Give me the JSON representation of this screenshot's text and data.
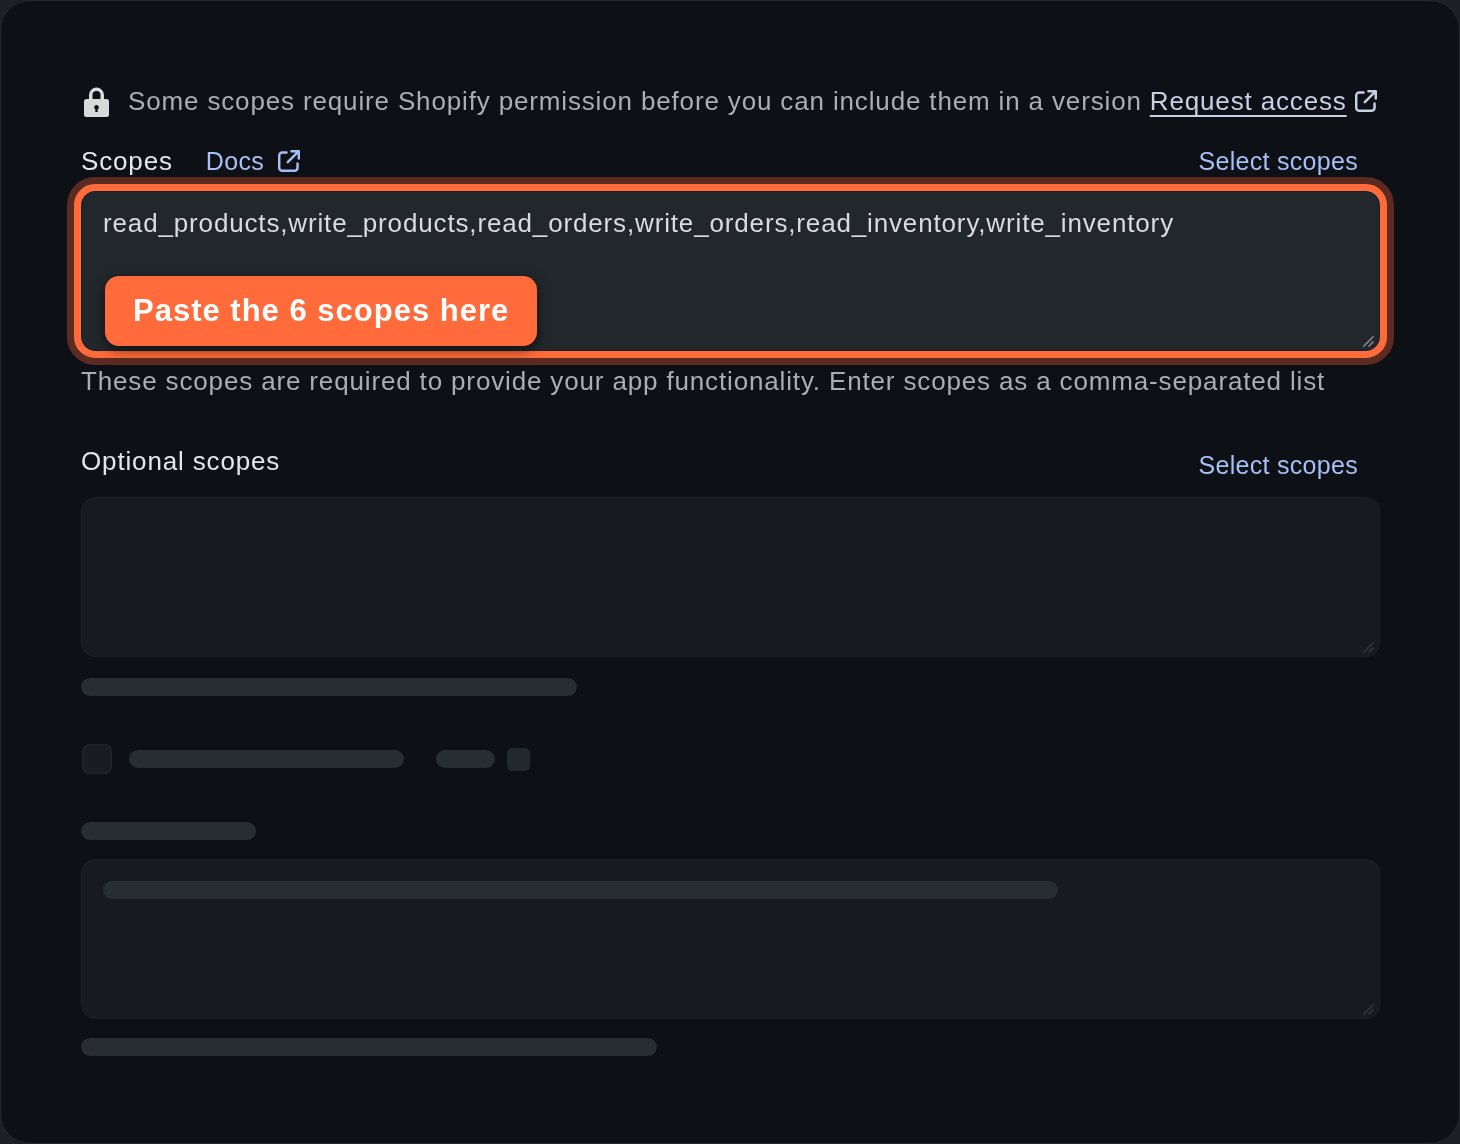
{
  "notice": {
    "text": "Some scopes require Shopify permission before you can include them in a version",
    "link": "Request access"
  },
  "scopes": {
    "label": "Scopes",
    "docs_link": "Docs",
    "action": "Select scopes",
    "value": "read_products,write_products,read_orders,write_orders,read_inventory,write_inventory",
    "highlighted": true,
    "callout": "Paste the 6 scopes here",
    "help": "These scopes are required to provide your app functionality. Enter scopes as a comma-separated list"
  },
  "optional_scopes": {
    "label": "Optional scopes",
    "action": "Select scopes",
    "blurred": true
  },
  "legacy_install": {
    "checked": false,
    "blurred": true
  },
  "redirect_urls": {
    "blurred": true
  }
}
